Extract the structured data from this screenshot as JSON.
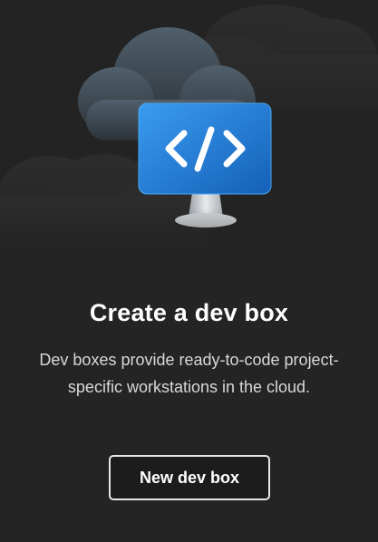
{
  "card": {
    "title": "Create a dev box",
    "description": "Dev boxes provide ready-to-code project-specific workstations in the cloud.",
    "button_label": "New dev box"
  },
  "illustration": {
    "icon": "cloud-monitor-code-icon",
    "symbol": "</>"
  },
  "colors": {
    "background": "#242424",
    "monitor_blue": "#1e7ad6",
    "cloud": "#3e4a55",
    "text": "#ffffff"
  }
}
